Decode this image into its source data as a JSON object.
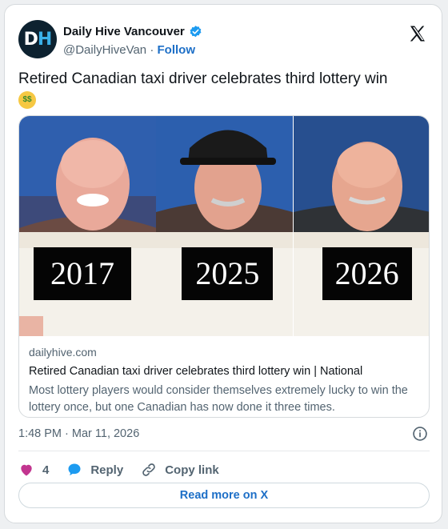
{
  "account": {
    "avatar_letters": [
      "D",
      "H"
    ],
    "display_name": "Daily Hive Vancouver",
    "handle": "@DailyHiveVan",
    "separator": " · ",
    "follow_label": "Follow"
  },
  "tweet": {
    "text": "Retired Canadian taxi driver celebrates third lottery win",
    "emoji": "money-mouth-face"
  },
  "link_card": {
    "years": [
      "2017",
      "2025",
      "2026"
    ],
    "domain": "dailyhive.com",
    "title": "Retired Canadian taxi driver celebrates third lottery win | National",
    "description": "Most lottery players would consider themselves extremely lucky to win the lottery once, but one Canadian has now done it three times."
  },
  "footer": {
    "timestamp": "1:48 PM · Mar 11, 2026",
    "like_count": "4",
    "reply_label": "Reply",
    "copy_link_label": "Copy link",
    "read_more_label": "Read more on X"
  },
  "colors": {
    "accent": "#1d6fc7",
    "heart": "#c2358f",
    "reply_bubble": "#1d9bf0",
    "verified": "#1d9bf0"
  }
}
